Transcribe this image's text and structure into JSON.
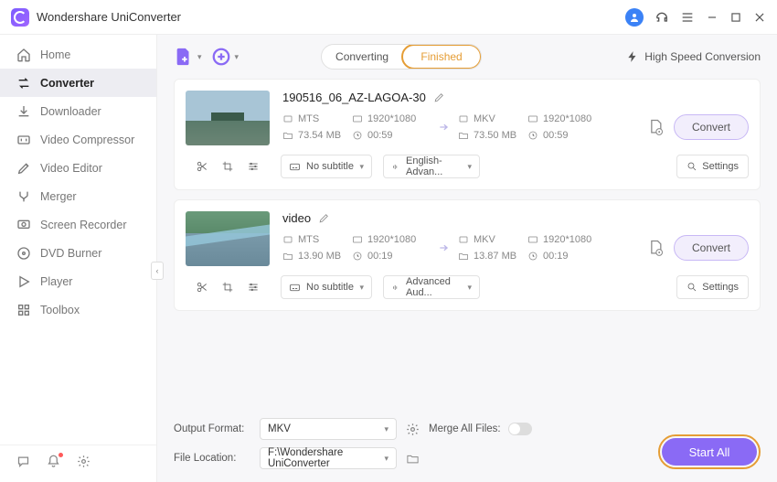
{
  "app": {
    "title": "Wondershare UniConverter"
  },
  "titlebar": {
    "user": true
  },
  "sidebar": {
    "items": [
      {
        "label": "Home"
      },
      {
        "label": "Converter"
      },
      {
        "label": "Downloader"
      },
      {
        "label": "Video Compressor"
      },
      {
        "label": "Video Editor"
      },
      {
        "label": "Merger"
      },
      {
        "label": "Screen Recorder"
      },
      {
        "label": "DVD Burner"
      },
      {
        "label": "Player"
      },
      {
        "label": "Toolbox"
      }
    ],
    "active_index": 1
  },
  "toolbar": {
    "tabs": {
      "converting": "Converting",
      "finished": "Finished",
      "active": "finished"
    },
    "hsc": "High Speed Conversion"
  },
  "items": [
    {
      "title": "190516_06_AZ-LAGOA-30",
      "thumb": "beach",
      "src": {
        "format": "MTS",
        "res": "1920*1080",
        "size": "73.54 MB",
        "dur": "00:59"
      },
      "dst": {
        "format": "MKV",
        "res": "1920*1080",
        "size": "73.50 MB",
        "dur": "00:59"
      },
      "subtitle": "No subtitle",
      "audio": "English-Advan...",
      "settings": "Settings",
      "convert": "Convert"
    },
    {
      "title": "video",
      "thumb": "city",
      "src": {
        "format": "MTS",
        "res": "1920*1080",
        "size": "13.90 MB",
        "dur": "00:19"
      },
      "dst": {
        "format": "MKV",
        "res": "1920*1080",
        "size": "13.87 MB",
        "dur": "00:19"
      },
      "subtitle": "No subtitle",
      "audio": "Advanced Aud...",
      "settings": "Settings",
      "convert": "Convert"
    }
  ],
  "footer": {
    "output_format_label": "Output Format:",
    "output_format_value": "MKV",
    "file_location_label": "File Location:",
    "file_location_value": "F:\\Wondershare UniConverter",
    "merge_label": "Merge All Files:",
    "start_all": "Start All"
  }
}
